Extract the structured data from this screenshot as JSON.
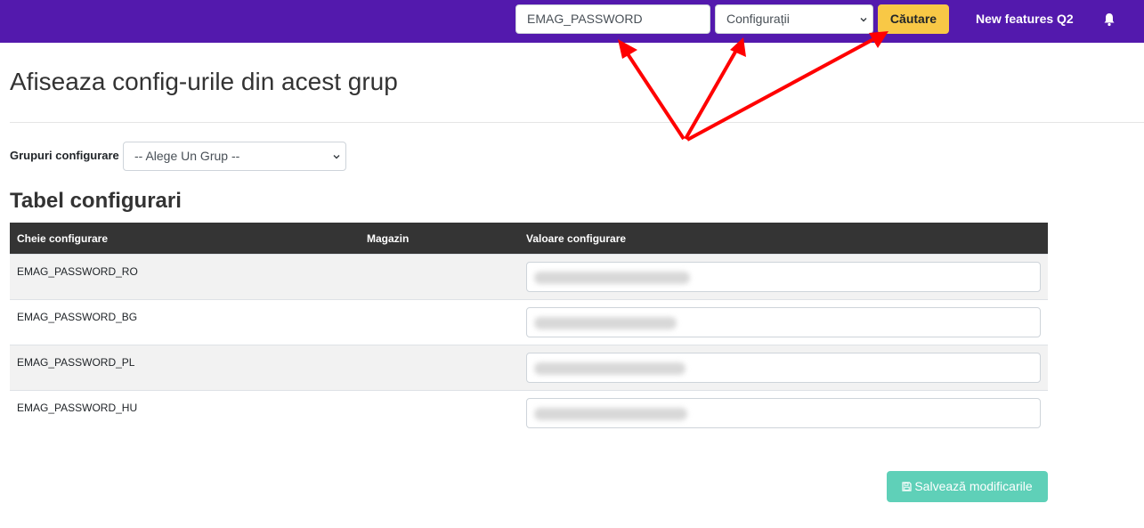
{
  "navbar": {
    "search_value": "EMAG_PASSWORD",
    "category_select": "Configurații",
    "search_button": "Căutare",
    "features_link": "New features Q2",
    "bell_icon": "bell-icon",
    "color_bg": "#5319ad",
    "color_button": "#f8c846"
  },
  "page": {
    "title": "Afiseaza config-urile din acest grup",
    "group_label": "Grupuri configurare",
    "group_select": "-- Alege Un Grup --",
    "section_title": "Tabel configurari"
  },
  "table": {
    "headers": [
      "Cheie configurare",
      "Magazin",
      "Valoare configurare"
    ],
    "rows": [
      {
        "key": "EMAG_PASSWORD_RO",
        "store": "",
        "value": ""
      },
      {
        "key": "EMAG_PASSWORD_BG",
        "store": "",
        "value": ""
      },
      {
        "key": "EMAG_PASSWORD_PL",
        "store": "",
        "value": ""
      },
      {
        "key": "EMAG_PASSWORD_HU",
        "store": "",
        "value": ""
      }
    ]
  },
  "save_button": {
    "label": "Salvează modificarile",
    "icon": "floppy-disk-icon",
    "color": "#5fd0b8"
  }
}
